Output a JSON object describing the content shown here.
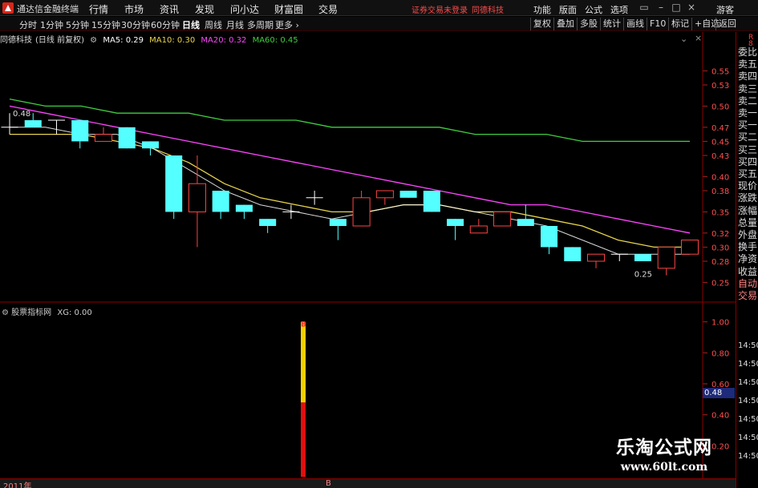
{
  "menubar": {
    "app_name": "通达信金融终端",
    "items": [
      "行情",
      "市场",
      "资讯",
      "发现",
      "问小达",
      "财富圈",
      "交易"
    ],
    "alert_text": "证券交易未登录",
    "alert_company": "同德科技",
    "right_items": [
      "功能",
      "版面",
      "公式",
      "选项"
    ],
    "guest_label": "游客"
  },
  "tabbar": {
    "periods": [
      "分时",
      "1分钟",
      "5分钟",
      "15分钟",
      "30分钟",
      "60分钟",
      "日线",
      "周线",
      "月线",
      "多周期",
      "更多"
    ],
    "active": "日线",
    "tools": [
      "复权",
      "叠加",
      "多股",
      "统计",
      "画线",
      "F10",
      "标记",
      "+自选",
      "返回"
    ]
  },
  "main_legend": {
    "stock": "同德科技",
    "period_desc": "(日线 前复权)",
    "ma5": "MA5: 0.29",
    "ma10": "MA10: 0.30",
    "ma20": "MA20: 0.32",
    "ma60": "MA60: 0.45",
    "colors": {
      "ma5": "#ffffff",
      "ma10": "#e8d44d",
      "ma20": "#ff44ff",
      "ma60": "#3fce3f"
    }
  },
  "price_axis": [
    "0.55",
    "0.53",
    "0.50",
    "0.47",
    "0.45",
    "0.43",
    "0.40",
    "0.38",
    "0.35",
    "0.32",
    "0.30",
    "0.28",
    "0.25"
  ],
  "price_marks": {
    "high": "0.48",
    "low": "0.25"
  },
  "side_panel": {
    "top": "R",
    "top2": "8",
    "labels": [
      "委比",
      "卖五",
      "卖四",
      "卖三",
      "卖二",
      "卖一",
      "买一",
      "买二",
      "买三",
      "买四",
      "买五",
      "现价",
      "涨跌",
      "涨幅",
      "总量",
      "外盘",
      "换手",
      "净资",
      "收益",
      "自动",
      "交易"
    ],
    "times": [
      "14:50",
      "14:50",
      "14:50",
      "14:50",
      "14:50",
      "14:50",
      "14:50"
    ]
  },
  "sub_legend": {
    "name": "股票指标网",
    "xg": "XG: 0.00"
  },
  "sub_axis": [
    "1.00",
    "0.80",
    "0.60",
    "0.48",
    "0.40",
    "0.20"
  ],
  "sub_price_flag": "0.48",
  "signal_label": "B",
  "bottom": {
    "year": "2011年",
    "marker": "B"
  },
  "watermark": {
    "title": "乐淘公式网",
    "url": "www.60lt.com"
  },
  "chart_data": [
    {
      "type": "candlestick",
      "ylim": [
        0.23,
        0.58
      ],
      "up_color": "#ff4444",
      "down_color": "#54ffff",
      "candles": [
        {
          "o": 0.47,
          "h": 0.49,
          "l": 0.46,
          "c": 0.47
        },
        {
          "o": 0.48,
          "h": 0.49,
          "l": 0.47,
          "c": 0.47
        },
        {
          "o": 0.48,
          "h": 0.48,
          "l": 0.46,
          "c": 0.48
        },
        {
          "o": 0.48,
          "h": 0.48,
          "l": 0.44,
          "c": 0.45
        },
        {
          "o": 0.45,
          "h": 0.47,
          "l": 0.45,
          "c": 0.46
        },
        {
          "o": 0.47,
          "h": 0.47,
          "l": 0.44,
          "c": 0.44
        },
        {
          "o": 0.45,
          "h": 0.45,
          "l": 0.43,
          "c": 0.44
        },
        {
          "o": 0.43,
          "h": 0.43,
          "l": 0.34,
          "c": 0.35
        },
        {
          "o": 0.35,
          "h": 0.43,
          "l": 0.3,
          "c": 0.39
        },
        {
          "o": 0.38,
          "h": 0.38,
          "l": 0.34,
          "c": 0.35
        },
        {
          "o": 0.36,
          "h": 0.36,
          "l": 0.34,
          "c": 0.35
        },
        {
          "o": 0.34,
          "h": 0.34,
          "l": 0.32,
          "c": 0.33
        },
        {
          "o": 0.35,
          "h": 0.36,
          "l": 0.34,
          "c": 0.35
        },
        {
          "o": 0.37,
          "h": 0.38,
          "l": 0.36,
          "c": 0.37
        },
        {
          "o": 0.34,
          "h": 0.34,
          "l": 0.31,
          "c": 0.33
        },
        {
          "o": 0.33,
          "h": 0.38,
          "l": 0.33,
          "c": 0.37
        },
        {
          "o": 0.37,
          "h": 0.38,
          "l": 0.36,
          "c": 0.38
        },
        {
          "o": 0.38,
          "h": 0.38,
          "l": 0.37,
          "c": 0.37
        },
        {
          "o": 0.38,
          "h": 0.38,
          "l": 0.35,
          "c": 0.35
        },
        {
          "o": 0.34,
          "h": 0.34,
          "l": 0.31,
          "c": 0.33
        },
        {
          "o": 0.32,
          "h": 0.34,
          "l": 0.32,
          "c": 0.33
        },
        {
          "o": 0.33,
          "h": 0.35,
          "l": 0.33,
          "c": 0.35
        },
        {
          "o": 0.34,
          "h": 0.36,
          "l": 0.33,
          "c": 0.33
        },
        {
          "o": 0.33,
          "h": 0.33,
          "l": 0.29,
          "c": 0.3
        },
        {
          "o": 0.3,
          "h": 0.3,
          "l": 0.28,
          "c": 0.28
        },
        {
          "o": 0.28,
          "h": 0.29,
          "l": 0.27,
          "c": 0.29
        },
        {
          "o": 0.29,
          "h": 0.29,
          "l": 0.28,
          "c": 0.29
        },
        {
          "o": 0.29,
          "h": 0.29,
          "l": 0.28,
          "c": 0.28
        },
        {
          "o": 0.27,
          "h": 0.3,
          "l": 0.26,
          "c": 0.3
        },
        {
          "o": 0.29,
          "h": 0.31,
          "l": 0.29,
          "c": 0.31
        }
      ],
      "ma_lines": [
        {
          "name": "MA60",
          "values": [
            0.51,
            0.5,
            0.5,
            0.49,
            0.49,
            0.49,
            0.48,
            0.48,
            0.48,
            0.47,
            0.47,
            0.47,
            0.47,
            0.46,
            0.46,
            0.46,
            0.45,
            0.45,
            0.45,
            0.45
          ]
        },
        {
          "name": "MA20",
          "values": [
            0.5,
            0.49,
            0.48,
            0.47,
            0.46,
            0.45,
            0.44,
            0.43,
            0.42,
            0.41,
            0.4,
            0.39,
            0.38,
            0.37,
            0.36,
            0.36,
            0.35,
            0.34,
            0.33,
            0.32
          ]
        },
        {
          "name": "MA10",
          "values": [
            0.46,
            0.46,
            0.46,
            0.45,
            0.44,
            0.42,
            0.39,
            0.37,
            0.36,
            0.35,
            0.35,
            0.36,
            0.36,
            0.35,
            0.35,
            0.34,
            0.33,
            0.31,
            0.3,
            0.3
          ]
        },
        {
          "name": "MA5",
          "values": [
            0.47,
            0.47,
            0.46,
            0.46,
            0.44,
            0.41,
            0.38,
            0.36,
            0.35,
            0.34,
            0.35,
            0.36,
            0.36,
            0.35,
            0.34,
            0.33,
            0.31,
            0.29,
            0.29,
            0.29
          ]
        }
      ]
    },
    {
      "type": "bar",
      "ylim": [
        0,
        1.05
      ],
      "signal_index": 13,
      "segments": [
        {
          "name": "red",
          "from": 0,
          "to": 0.48,
          "color": "#e01010"
        },
        {
          "name": "yellow",
          "from": 0.48,
          "to": 1.0,
          "color": "#f2d000"
        }
      ]
    }
  ]
}
